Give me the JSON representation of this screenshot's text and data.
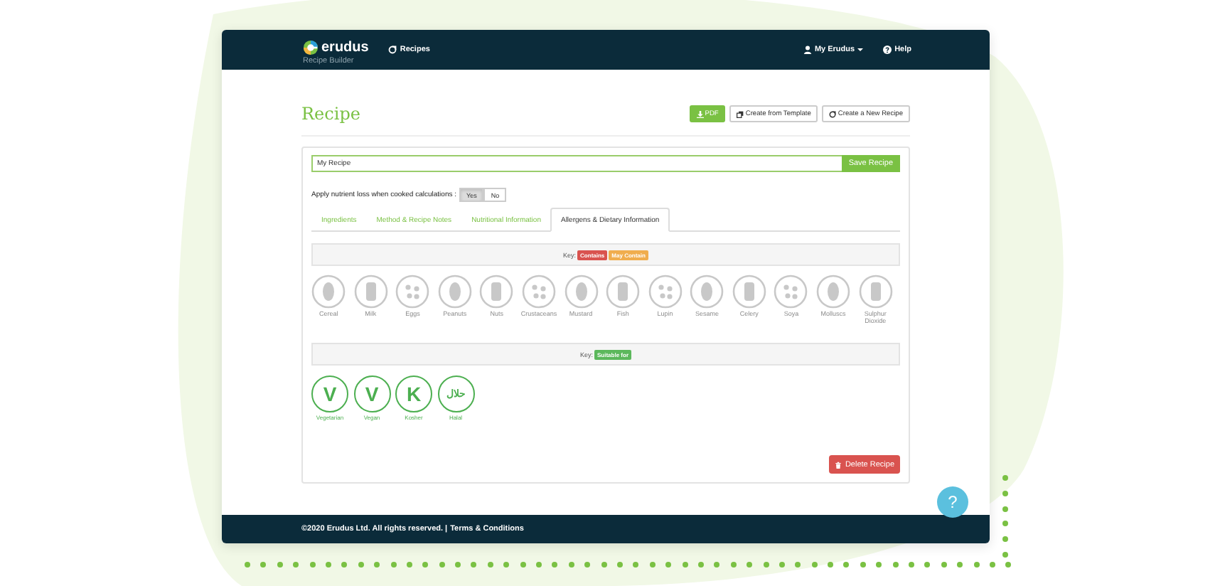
{
  "navbar": {
    "brand": "erudus",
    "subtitle": "Recipe Builder",
    "links": [
      {
        "label": "Recipes"
      }
    ],
    "right_links": [
      {
        "label": "My Erudus",
        "dropdown": true
      },
      {
        "label": "Help",
        "dropdown": false
      }
    ]
  },
  "page_title": "Recipe",
  "actions": [
    {
      "label": "PDF",
      "kind": "primary"
    },
    {
      "label": "Create from Template",
      "kind": "default"
    },
    {
      "label": "Create a New Recipe",
      "kind": "default"
    }
  ],
  "recipe_name": {
    "value": "My Recipe",
    "button": "Save Recipe"
  },
  "nutrient_loss": {
    "label": "Apply nutrient loss when cooked calculations :",
    "options": [
      {
        "label": "Yes",
        "selected": true
      },
      {
        "label": "No",
        "selected": false
      }
    ]
  },
  "tabs": [
    {
      "label": "Ingredients",
      "selected": false
    },
    {
      "label": "Method & Recipe Notes",
      "selected": false
    },
    {
      "label": "Nutritional Information",
      "selected": false
    },
    {
      "label": "Allergens & Dietary Information",
      "selected": true
    }
  ],
  "allergen_key": {
    "label": "Key:",
    "badges": [
      {
        "label": "Contains",
        "color": "#d9534f"
      },
      {
        "label": "May Contain",
        "color": "#f0ad4e"
      }
    ]
  },
  "allergens": [
    {
      "label": "Cereal"
    },
    {
      "label": "Milk"
    },
    {
      "label": "Eggs"
    },
    {
      "label": "Peanuts"
    },
    {
      "label": "Nuts"
    },
    {
      "label": "Crustaceans"
    },
    {
      "label": "Mustard"
    },
    {
      "label": "Fish"
    },
    {
      "label": "Lupin"
    },
    {
      "label": "Sesame"
    },
    {
      "label": "Celery"
    },
    {
      "label": "Soya"
    },
    {
      "label": "Molluscs"
    },
    {
      "label": "Sulphur Dioxide"
    }
  ],
  "dietary_key": {
    "label": "Key:",
    "badges": [
      {
        "label": "Suitable for",
        "color": "#5cb85c"
      }
    ]
  },
  "dietary": [
    {
      "label": "Vegetarian",
      "symbol": "V",
      "suitable": true
    },
    {
      "label": "Vegan",
      "symbol": "V",
      "suitable": true
    },
    {
      "label": "Kosher",
      "symbol": "K",
      "suitable": true
    },
    {
      "label": "Halal",
      "symbol": "حلال",
      "suitable": true
    }
  ],
  "delete_button": "Delete Recipe",
  "footer": {
    "copyright": "©2020 Erudus Ltd. All rights reserved. |",
    "link": "Terms & Conditions"
  },
  "help_bubble": "?"
}
